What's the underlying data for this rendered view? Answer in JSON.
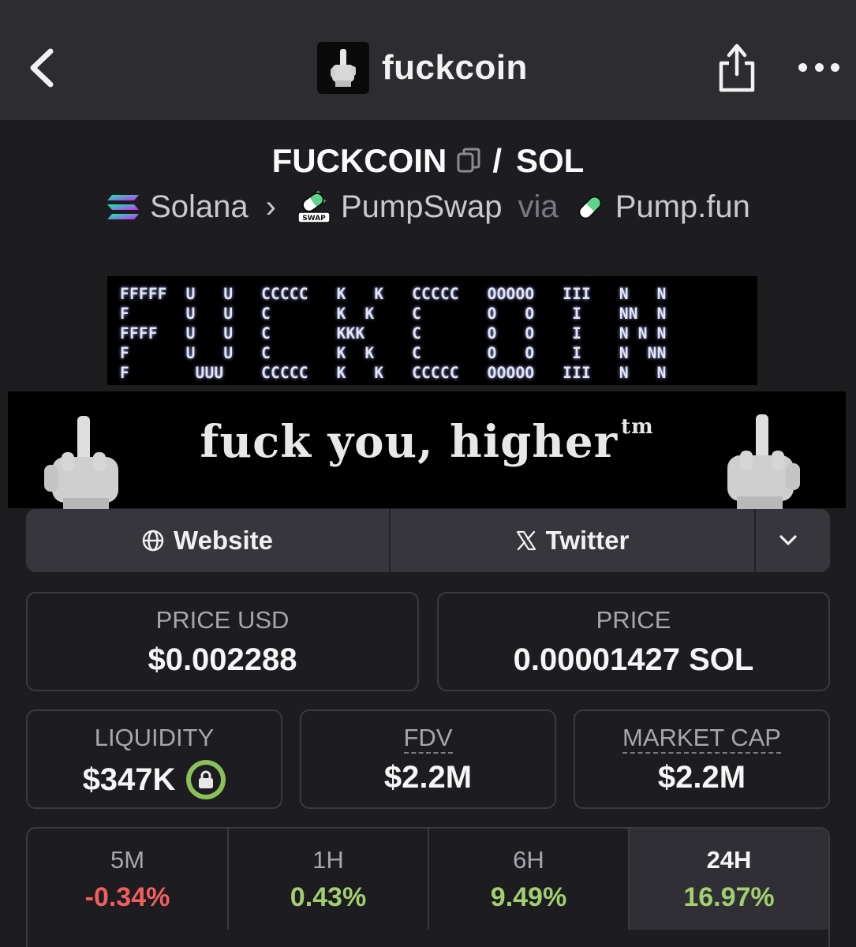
{
  "header": {
    "token_name": "fuckcoin",
    "icons": {
      "back": "chevron-left-icon",
      "share": "share-icon",
      "more": "more-dots-icon"
    }
  },
  "pair": {
    "base": "FUCKCOIN",
    "slash": "/",
    "quote": "SOL",
    "chain": "Solana",
    "dex": "PumpSwap",
    "via": "via",
    "launchpad": "Pump.fun"
  },
  "banner": {
    "ascii_lines": [
      "FFFFF  U   U   CCCCC   K   K   CCCCC   OOOOO   III   N   N",
      "F      U   U   C       K  K    C       O   O    I    NN  N",
      "FFFF   U   U   C       KKK     C       O   O    I    N N N",
      "F      U   U   C       K  K    C       O   O    I    N  NN",
      "F       UUU    CCCCC   K   K   CCCCC   OOOOO   III   N   N"
    ],
    "slogan": "fuck you, higher",
    "slogan_mark": "tm"
  },
  "links": {
    "website": "Website",
    "twitter": "Twitter"
  },
  "stats": {
    "price_usd": {
      "label": "PRICE USD",
      "value": "$0.002288"
    },
    "price_native": {
      "label": "PRICE",
      "value": "0.00001427 SOL"
    },
    "liquidity": {
      "label": "LIQUIDITY",
      "value": "$347K"
    },
    "fdv": {
      "label": "FDV",
      "value": "$2.2M"
    },
    "market_cap": {
      "label": "MARKET CAP",
      "value": "$2.2M"
    }
  },
  "timeframes": [
    {
      "label": "5M",
      "change": "-0.34%",
      "direction": "down"
    },
    {
      "label": "1H",
      "change": "0.43%",
      "direction": "up"
    },
    {
      "label": "6H",
      "change": "9.49%",
      "direction": "up"
    },
    {
      "label": "24H",
      "change": "16.97%",
      "direction": "up",
      "selected": true
    }
  ],
  "colors": {
    "background": "#1c1c21",
    "topbar": "#2c2c31",
    "negative": "#f05f5f",
    "positive": "#a3cf70",
    "lock_green": "#8ac15a"
  }
}
